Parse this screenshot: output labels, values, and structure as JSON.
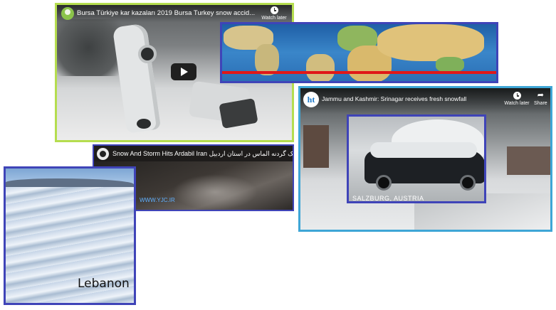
{
  "cards": {
    "bursa": {
      "title": "Bursa Türkiye kar kazaları 2019 Bursa Turkey snow accid...",
      "watch_later": "Watch later"
    },
    "ardabil": {
      "title": "Snow And Storm Hits Ardabil Iran یک گردنه الماس در استان اردبیل",
      "url": "WWW.YJC.IR"
    },
    "lebanon": {
      "label": "Lebanon"
    },
    "jammu": {
      "title": "Jammu and Kashmir: Srinagar receives fresh snowfall",
      "watch_later": "Watch later",
      "share": "Share",
      "channel_logo": "ht"
    },
    "salzburg": {
      "label": "SALZBURG, AUSTRIA"
    }
  },
  "colors": {
    "green_border": "#b5dd4f",
    "blue_border": "#3f44b8",
    "cyan_border": "#3ea6d6",
    "equator_line": "#e01818"
  },
  "icons": [
    "play-icon",
    "clock-icon",
    "share-icon",
    "channel-avatar-icon"
  ]
}
